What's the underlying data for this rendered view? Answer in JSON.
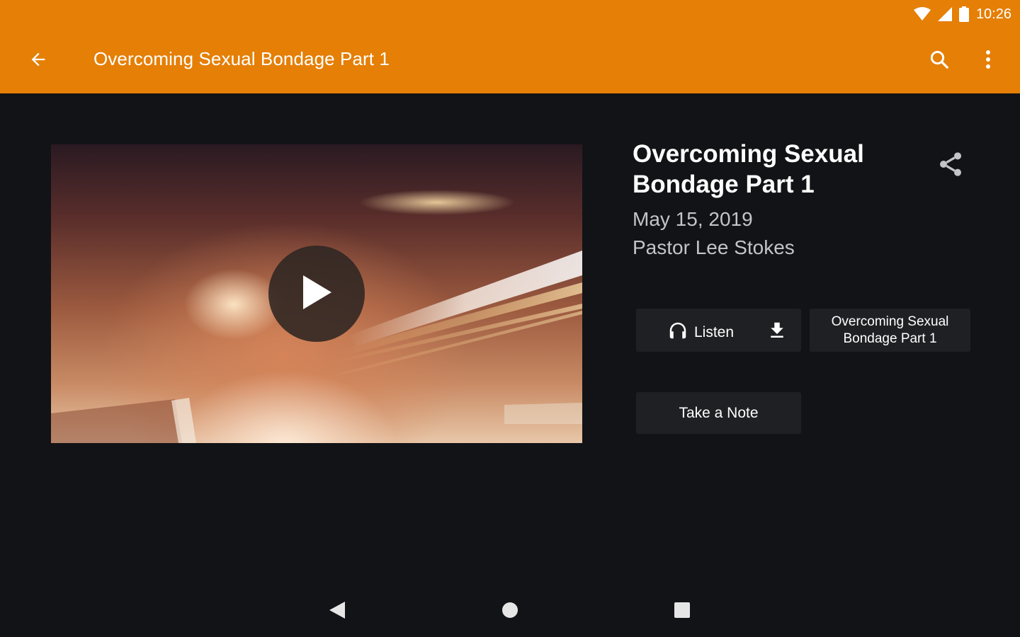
{
  "status_bar": {
    "time": "10:26",
    "icons": [
      "wifi-icon",
      "cell-signal-icon",
      "battery-icon"
    ]
  },
  "toolbar": {
    "title": "Overcoming Sexual Bondage Part 1",
    "back_icon": "arrow-back-icon",
    "search_icon": "search-icon",
    "more_icon": "more-vert-icon",
    "color": "#E57F06"
  },
  "video": {
    "play_icon": "play-icon"
  },
  "sermon": {
    "title": "Overcoming Sexual Bondage Part 1",
    "date": "May 15, 2019",
    "speaker": "Pastor Lee Stokes",
    "share_icon": "share-icon"
  },
  "actions": {
    "listen_label": "Listen",
    "listen_icon": "headphones-icon",
    "download_icon": "download-icon",
    "series_label": "Overcoming Sexual Bondage Part 1",
    "note_label": "Take a Note"
  },
  "nav_bar": {
    "back_icon": "nav-back-icon",
    "home_icon": "nav-home-icon",
    "recents_icon": "nav-recents-icon"
  },
  "colors": {
    "accent": "#E57F06",
    "background": "#121316",
    "button": "#1e2023",
    "secondary_text": "#c3c4c6"
  }
}
